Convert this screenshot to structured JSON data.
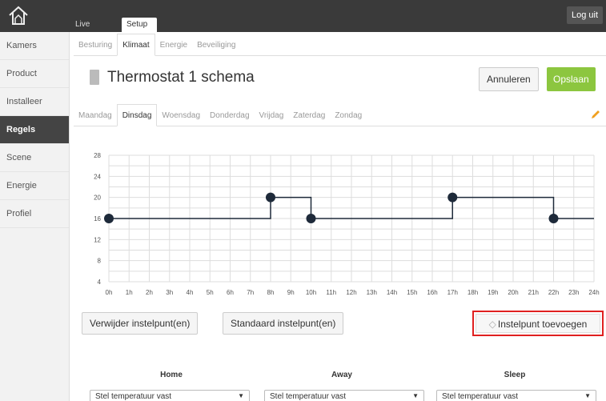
{
  "topbar": {
    "tabs": [
      "Live",
      "Setup"
    ],
    "logout": "Log uit"
  },
  "sidebar": {
    "items": [
      "Kamers",
      "Product",
      "Installeer",
      "Regels",
      "Scene",
      "Energie",
      "Profiel"
    ],
    "active": "Regels"
  },
  "subtabs": {
    "items": [
      "Besturing",
      "Klimaat",
      "Energie",
      "Beveiliging"
    ],
    "active": "Klimaat"
  },
  "header": {
    "title": "Thermostat 1 schema",
    "cancel": "Annuleren",
    "save": "Opslaan"
  },
  "days": {
    "items": [
      "Maandag",
      "Dinsdag",
      "Woensdag",
      "Donderdag",
      "Vrijdag",
      "Zaterdag",
      "Zondag"
    ],
    "active": "Dinsdag"
  },
  "chart_data": {
    "type": "line",
    "step": true,
    "x_ticks": [
      "0h",
      "1h",
      "2h",
      "3h",
      "4h",
      "5h",
      "6h",
      "7h",
      "8h",
      "9h",
      "10h",
      "11h",
      "12h",
      "13h",
      "14h",
      "15h",
      "16h",
      "17h",
      "18h",
      "19h",
      "20h",
      "21h",
      "22h",
      "23h",
      "24h"
    ],
    "y_ticks": [
      4,
      8,
      12,
      16,
      20,
      24,
      28
    ],
    "xlim": [
      0,
      24
    ],
    "ylim": [
      4,
      28
    ],
    "grid": true,
    "setpoints": [
      {
        "x": 0,
        "y": 16
      },
      {
        "x": 8,
        "y": 20
      },
      {
        "x": 10,
        "y": 16
      },
      {
        "x": 17,
        "y": 20
      },
      {
        "x": 22,
        "y": 16
      }
    ],
    "line_color": "#1e2a3a",
    "grid_color": "#dddddd"
  },
  "actions": {
    "delete": "Verwijder instelpunt(en)",
    "standard": "Standaard instelpunt(en)",
    "add": "Instelpunt toevoegen",
    "add_icon": "plus-diamond-icon"
  },
  "modes": [
    "Home",
    "Away",
    "Sleep"
  ],
  "selects": [
    "Stel temperatuur vast",
    "Stel temperatuur vast",
    "Stel temperatuur vast"
  ],
  "colors": {
    "save": "#8cc63f",
    "highlight": "#e02020",
    "sidebar_active": "#444444"
  }
}
